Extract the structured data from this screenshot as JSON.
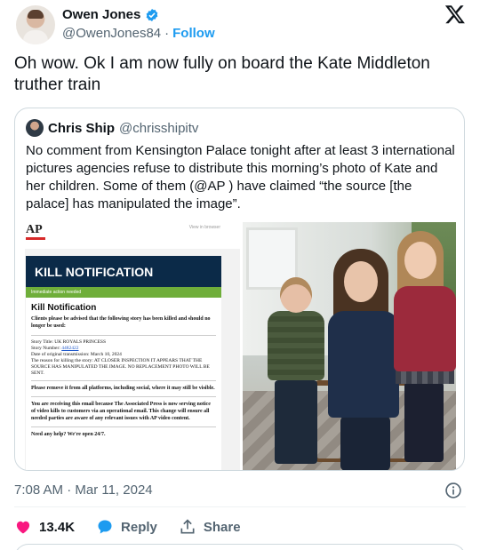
{
  "author": {
    "name": "Owen Jones",
    "handle": "@OwenJones84",
    "separator": "·",
    "follow_label": "Follow"
  },
  "tweet": {
    "text": "Oh wow. Ok I am now fully on board the Kate Middleton truther train"
  },
  "quote": {
    "name": "Chris Ship",
    "handle": "@chrisshipitv",
    "text": "No comment from Kensington Palace tonight after at least 3 international pictures agencies refuse to distribute this morning’s photo of Kate and her children.  Some of them (@AP ) have claimed “the source [the palace] has manipulated the image”.",
    "ap_notice": {
      "logo": "AP",
      "view_in_browser": "View in browser",
      "banner": "KILL NOTIFICATION",
      "immediate": "Immediate action needed",
      "title": "Kill Notification",
      "intro": "Clients please be advised that the following story has been killed and should no longer be used:",
      "story_title": "Story Title: UK ROYALS PRINCESS",
      "story_number_label": "Story Number:",
      "story_number": "4482422",
      "date_line": "Date of original transmission: March 10, 2024",
      "reason": "The reason for killing the story: AT CLOSER INSPECTION IT APPEARS THAT THE SOURCE HAS MANIPULATED THE IMAGE. NO REPLACEMENT PHOTO WILL BE SENT.",
      "remove": "Please remove it from all platforms, including social, where it may still be visible.",
      "receiving": "You are receiving this email because The Associated Press is now serving notice of video kills to customers via an operational email. This change will ensure all needed parties are aware of any relevant issues with AP video content.",
      "help": "Need any help? We're open 24/7."
    }
  },
  "meta": {
    "timestamp": "7:08 AM · Mar 11, 2024"
  },
  "actions": {
    "likes": "13.4K",
    "reply_label": "Reply",
    "share_label": "Share"
  },
  "colors": {
    "accent": "#1d9bf0",
    "heart": "#f91880",
    "text": "#0f1419",
    "muted": "#536471"
  },
  "icons": [
    "verified-badge-icon",
    "x-logo-icon",
    "info-icon",
    "heart-icon",
    "reply-bubble-icon",
    "share-icon"
  ]
}
